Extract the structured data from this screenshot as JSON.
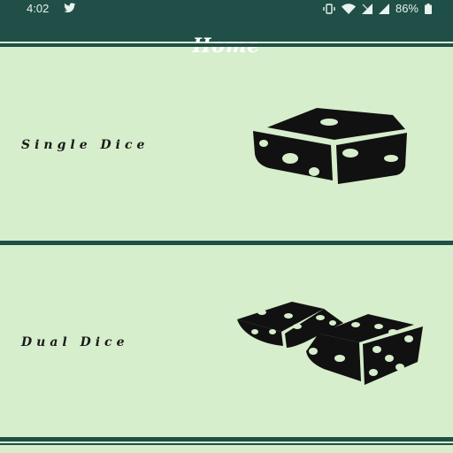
{
  "status_bar": {
    "time": "4:02",
    "battery": "86%"
  },
  "app_bar": {
    "title": "Home"
  },
  "cards": {
    "single": {
      "label": "Single Dice"
    },
    "dual": {
      "label": "Dual Dice"
    }
  },
  "colors": {
    "primary": "#1f4f47",
    "background": "#d6eecb",
    "dice": "#111111"
  }
}
